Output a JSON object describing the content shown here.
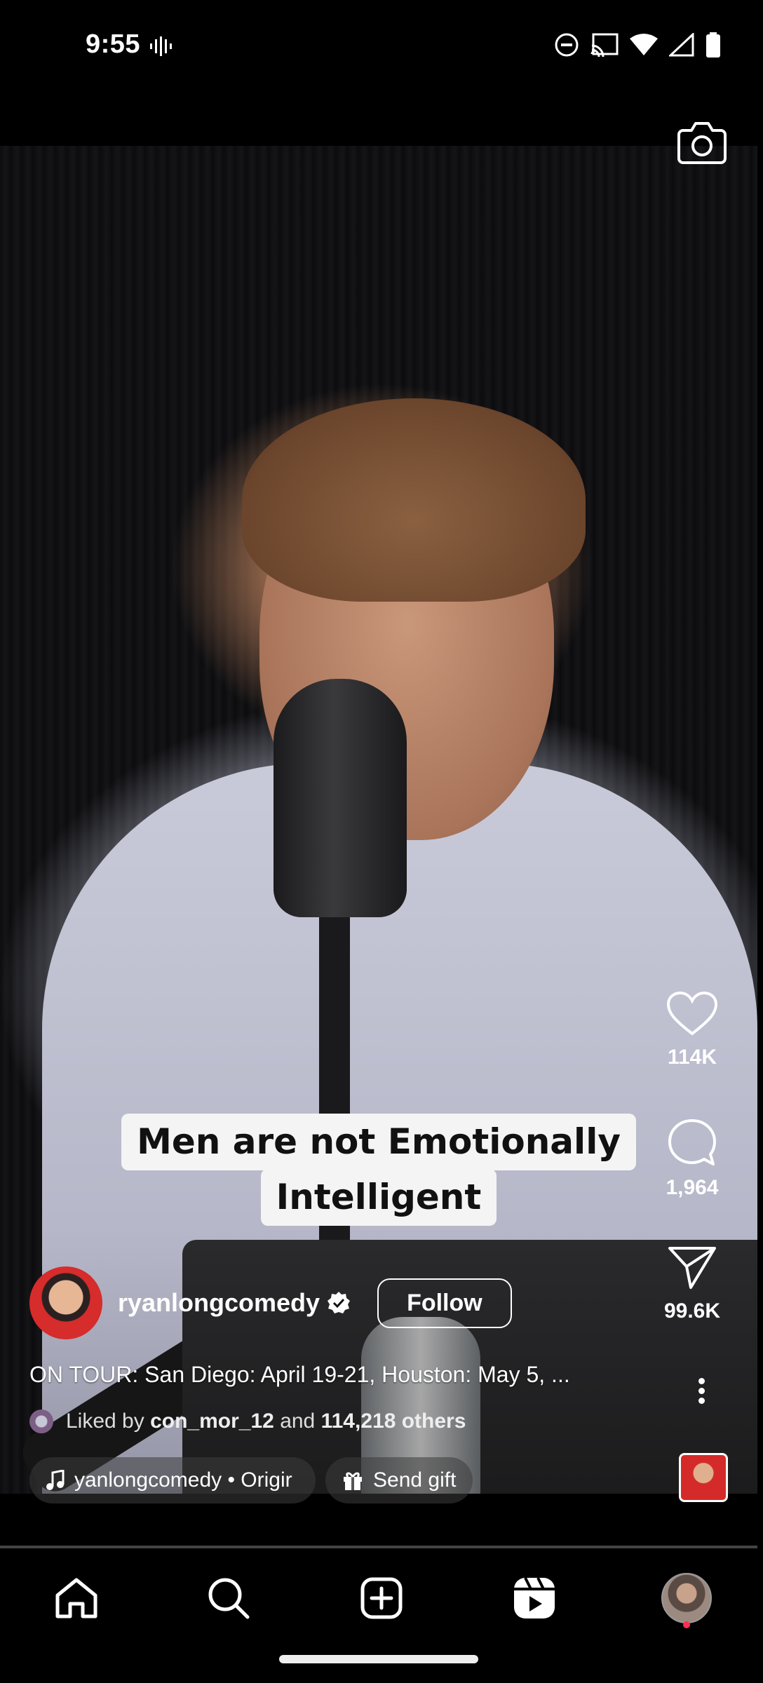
{
  "status_bar": {
    "time": "9:55"
  },
  "reel": {
    "caption_line1": "Men are not Emotionally",
    "caption_line2": "Intelligent",
    "likes": "114K",
    "comments": "1,964",
    "shares": "99.6K",
    "author": {
      "username": "ryanlongcomedy",
      "verified": true,
      "follow_label": "Follow"
    },
    "description": "ON TOUR: San Diego: April 19-21, Houston: May 5, ...",
    "liked_by": {
      "prefix": "Liked by",
      "user": "con_mor_12",
      "middle": "and",
      "others": "114,218 others"
    },
    "audio_label": "yanlongcomedy • Origir",
    "send_gift_label": "Send gift"
  },
  "nav": {
    "items": [
      "home-icon",
      "search-icon",
      "create-icon",
      "reels-icon",
      "profile"
    ]
  },
  "colors": {
    "notification_dot": "#ff2d55",
    "avatar_ring": "#d62c2c"
  }
}
